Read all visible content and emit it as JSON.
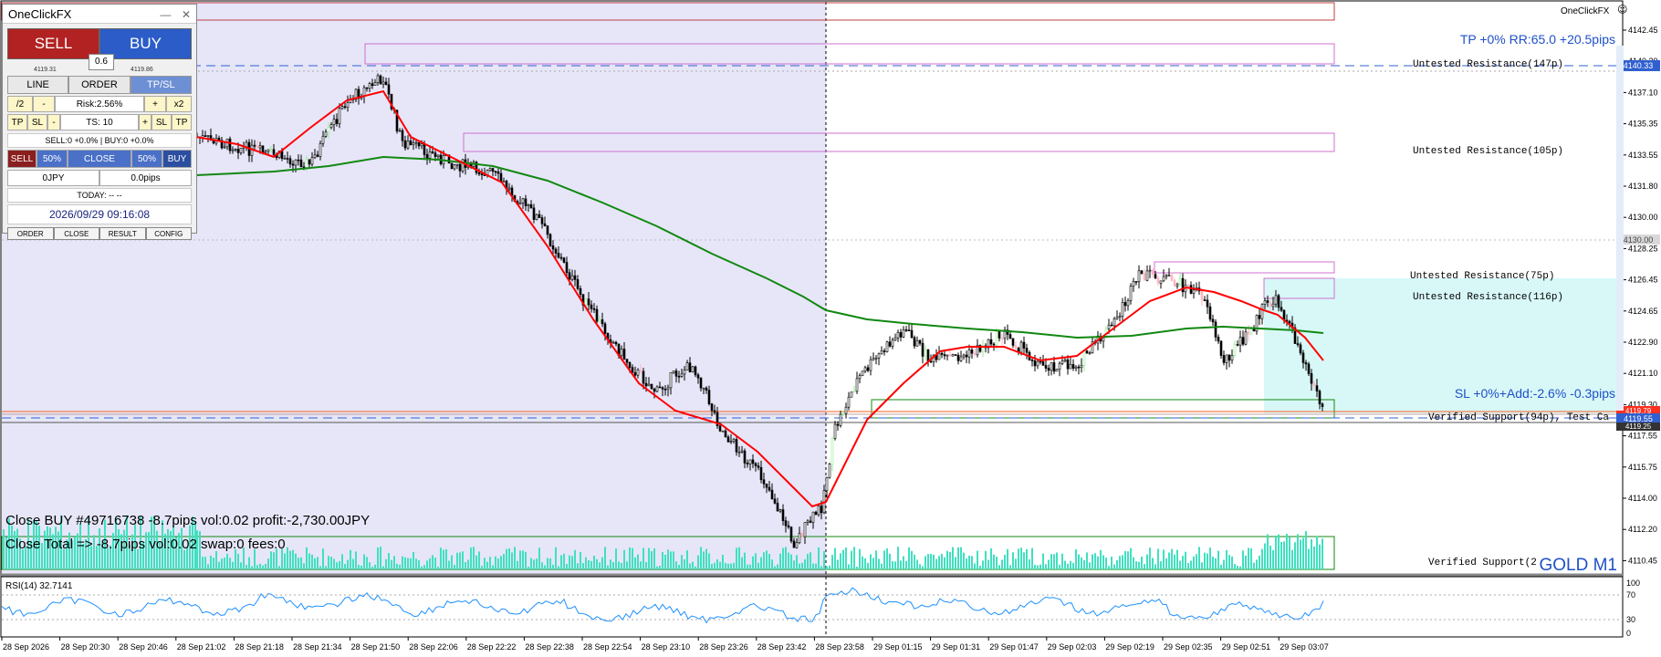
{
  "app_title": "OneClickFX",
  "brand_label": "OneClickFX",
  "panel": {
    "sell_label": "SELL",
    "buy_label": "BUY",
    "lot_value": "0.6",
    "sell_price": "4119.31",
    "buy_price": "4119.86",
    "tabs": [
      "LINE",
      "ORDER",
      "TP/SL"
    ],
    "active_tab": "TP/SL",
    "half_label": "/2",
    "minus_label": "-",
    "risk_label": "Risk:2.56%",
    "plus_label": "+",
    "double_label": "x2",
    "tp_label": "TP",
    "sl_label": "SL",
    "ts_label": "TS: 10",
    "position_info": "SELL:0 +0.0% | BUY:0 +0.0%",
    "sell_small": "SELL",
    "half_pct_left": "50%",
    "close_label": "CLOSE",
    "half_pct_right": "50%",
    "buy_small": "BUY",
    "profit_jpy": "0JPY",
    "profit_pips": "0.0pips",
    "today_label": "TODAY: -- --",
    "datetime": "2026/09/29  09:16:08",
    "nav": [
      "ORDER",
      "CLOSE",
      "RESULT",
      "CONFIG"
    ]
  },
  "symbol_label": "GOLD M1",
  "tp_annotation": "TP +0% RR:65.0 +20.5pips",
  "sl_annotation": "SL +0%+Add:-2.6% -0.3pips",
  "close_messages": [
    "Close BUY #49716738 -8.7pips vol:0.02 profit:-2,730.00JPY",
    "Close Total => -8.7pips vol:0.02 swap:0 fees:0"
  ],
  "zone_labels": [
    "Untested Resistance(147p)",
    "Untested Resistance(105p)",
    "Untested Resistance(75p)",
    "Untested Resistance(116p)",
    "Verified Support(94p), Test Ca",
    "Verified Support(2"
  ],
  "price_axis": {
    "ticks": [
      "4142.45",
      "4140.30",
      "4137.10",
      "4135.35",
      "4133.55",
      "4131.80",
      "4130.00",
      "4128.25",
      "4126.45",
      "4124.65",
      "4122.90",
      "4121.10",
      "4119.30",
      "4117.55",
      "4115.75",
      "4114.00",
      "4112.20",
      "4110.45"
    ],
    "current_label": "4140.33",
    "bid_label": "4119.55",
    "ask_label": "4119.79",
    "low_label": "4119.25",
    "round_label": "4130.00"
  },
  "time_axis": [
    "28 Sep 2026",
    "28 Sep 20:30",
    "28 Sep 20:46",
    "28 Sep 21:02",
    "28 Sep 21:18",
    "28 Sep 21:34",
    "28 Sep 21:50",
    "28 Sep 22:06",
    "28 Sep 22:22",
    "28 Sep 22:38",
    "28 Sep 22:54",
    "28 Sep 23:10",
    "28 Sep 23:26",
    "28 Sep 23:42",
    "28 Sep 23:58",
    "29 Sep 01:15",
    "29 Sep 01:31",
    "29 Sep 01:47",
    "29 Sep 02:03",
    "29 Sep 02:19",
    "29 Sep 02:35",
    "29 Sep 02:51",
    "29 Sep 03:07"
  ],
  "rsi": {
    "label": "RSI(14) 32.7141",
    "levels": [
      "70",
      "30"
    ],
    "ticks": [
      "100",
      "70",
      "30",
      "0"
    ]
  },
  "colors": {
    "ma_fast": "#ff0000",
    "ma_slow": "#118811",
    "bull_candle": "#90ee90",
    "bear_candle": "#ffb6c1",
    "volume": "#40e0c0",
    "rsi": "#1e90ff",
    "resistance": "#cc44cc",
    "support": "#118811",
    "label_blue": "#1e50c8"
  }
}
